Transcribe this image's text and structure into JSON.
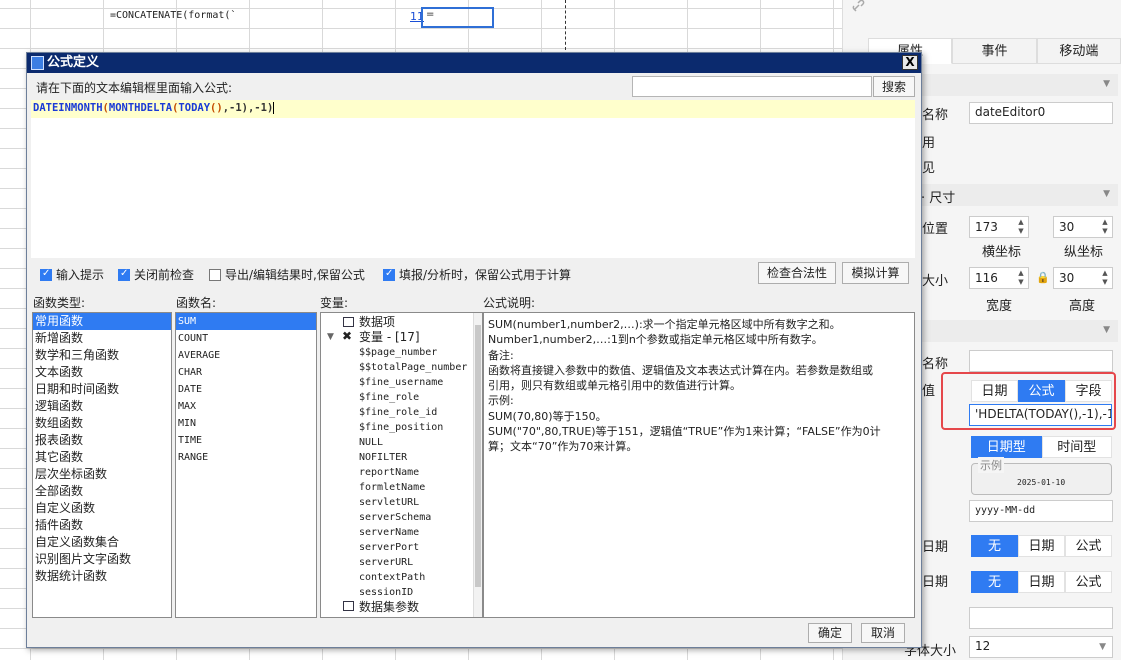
{
  "sheet": {
    "formula_text": "=CONCATENATE(format(`",
    "link_value": "11",
    "selected_cell_text": "="
  },
  "right_panel": {
    "tabs": [
      "属性",
      "事件",
      "移动端"
    ],
    "rows": {
      "name_label": "名称",
      "name_value": "dateEditor0",
      "enable_label": "用",
      "visible_label": "见",
      "size_section": "· 尺寸",
      "position_label": "位置",
      "x_value": "173",
      "y_value": "30",
      "x_caption": "横坐标",
      "y_caption": "纵坐标",
      "size_label": "大小",
      "w_value": "116",
      "h_value": "30",
      "w_caption": "宽度",
      "h_caption": "高度",
      "name2_label": "名称",
      "value_label": "值",
      "value_modes": [
        "日期",
        "公式",
        "字段"
      ],
      "formula_preview": "'HDELTA(TODAY(),-1),-1)",
      "date_types": [
        "日期型",
        "时间型"
      ],
      "example_legend": "示例",
      "example_value": "2025-01-10",
      "format_value": "yyyy-MM-dd",
      "start_label": "日期",
      "start_modes": [
        "无",
        "日期",
        "公式"
      ],
      "end_label": "日期",
      "end_modes": [
        "无",
        "日期",
        "公式"
      ],
      "font_label": "字体大小",
      "font_value": "12"
    }
  },
  "dialog": {
    "title": "公式定义",
    "close_label": "X",
    "prompt": "请在下面的文本编辑框里面输入公式:",
    "search_button": "搜索",
    "formula": {
      "f1": "DATEINMONTH",
      "p1": "(",
      "f2": "MONTHDELTA",
      "p2": "(",
      "f3": "TODAY",
      "p3": "()",
      "t1": ",-1)",
      "t2": ",-1)"
    },
    "options": {
      "input_hint": "输入提示",
      "check_before_close": "关闭前检查",
      "keep_formula_export": "导出/编辑结果时,保留公式",
      "keep_formula_fill": "填报/分析时，保留公式用于计算"
    },
    "check_validity_button": "检查合法性",
    "simulate_button": "模拟计算",
    "headers": {
      "function_types": "函数类型:",
      "function_names": "函数名:",
      "variables": "变量:",
      "description": "公式说明:"
    },
    "function_types": [
      "常用函数",
      "新增函数",
      "数学和三角函数",
      "文本函数",
      "日期和时间函数",
      "逻辑函数",
      "数组函数",
      "报表函数",
      "其它函数",
      "层次坐标函数",
      "全部函数",
      "自定义函数",
      "插件函数",
      "自定义函数集合",
      "识别图片文字函数",
      "数据统计函数"
    ],
    "function_names": [
      "SUM",
      "COUNT",
      "AVERAGE",
      "CHAR",
      "DATE",
      "MAX",
      "MIN",
      "TIME",
      "RANGE"
    ],
    "variables": {
      "data_item": "数据项",
      "var_group": "变量 - [17]",
      "items": [
        "$$page_number",
        "$$totalPage_number",
        "$fine_username",
        "$fine_role",
        "$fine_role_id",
        "$fine_position",
        "NULL",
        "NOFILTER",
        "reportName",
        "formletName",
        "servletURL",
        "serverSchema",
        "serverName",
        "serverPort",
        "serverURL",
        "contextPath",
        "sessionID"
      ],
      "dataset_params": "数据集参数"
    },
    "description_lines": [
      "SUM(number1,number2,…):求一个指定单元格区域中所有数字之和。",
      "Number1,number2,…:1到n个参数或指定单元格区域中所有数字。",
      "备注:",
      "函数将直接键入参数中的数值、逻辑值及文本表达式计算在内。若参数是数组或",
      "引用，则只有数组或单元格引用中的数值进行计算。",
      "示例:",
      "SUM(70,80)等于150。",
      "SUM(\"70\",80,TRUE)等于151，逻辑值“TRUE”作为1来计算；“FALSE”作为0计",
      "算；文本“70”作为70来计算。"
    ],
    "ok_button": "确定",
    "cancel_button": "取消"
  }
}
